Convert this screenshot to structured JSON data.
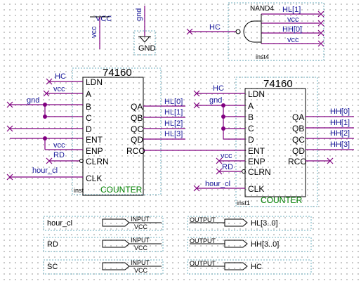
{
  "power": {
    "vcc": "VCC",
    "vcc_net": "vcc",
    "gnd_net": "gnd",
    "gnd": "GND"
  },
  "nand": {
    "name": "NAND4",
    "inst": "inst4",
    "input": "HC",
    "pins": [
      "HL[1]",
      "vcc",
      "HH[0]",
      "vcc"
    ]
  },
  "counter1": {
    "title": "74160",
    "inst": "inst",
    "label": "COUNTER",
    "left_pins": [
      "LDN",
      "A",
      "B",
      "C",
      "D",
      "ENT",
      "ENP",
      "CLRN",
      "CLK"
    ],
    "right_pins": [
      "QA",
      "QB",
      "QC",
      "QD",
      "RCO"
    ],
    "left_nets": [
      "HC",
      "vcc",
      "gnd",
      "vcc",
      "RD",
      "hour_cl"
    ],
    "out_nets": [
      "HL[0]",
      "HL[1]",
      "HL[2]",
      "HL[3]"
    ]
  },
  "counter2": {
    "title": "74160",
    "inst": "inst1",
    "label": "COUNTER",
    "left_pins": [
      "LDN",
      "A",
      "B",
      "C",
      "D",
      "ENT",
      "ENP",
      "CLRN",
      "CLK"
    ],
    "right_pins": [
      "QA",
      "QB",
      "QC",
      "QD",
      "RCO"
    ],
    "left_nets": [
      "HC",
      "gnd",
      "vcc",
      "RD",
      "hour_cl"
    ],
    "out_nets": [
      "HH[0]",
      "HH[1]",
      "HH[2]",
      "HH[3]"
    ]
  },
  "io": {
    "inputs": [
      {
        "name": "hour_cl",
        "tag": "INPUT",
        "sub": "VCC"
      },
      {
        "name": "RD",
        "tag": "INPUT",
        "sub": "VCC"
      },
      {
        "name": "SC",
        "tag": "INPUT",
        "sub": "VCC"
      }
    ],
    "outputs": [
      {
        "tag": "OUTPUT",
        "name": "HL[3..0]"
      },
      {
        "tag": "OUTPUT",
        "name": "HH[3..0]"
      },
      {
        "tag": "OUTPUT",
        "name": "HC"
      }
    ]
  }
}
